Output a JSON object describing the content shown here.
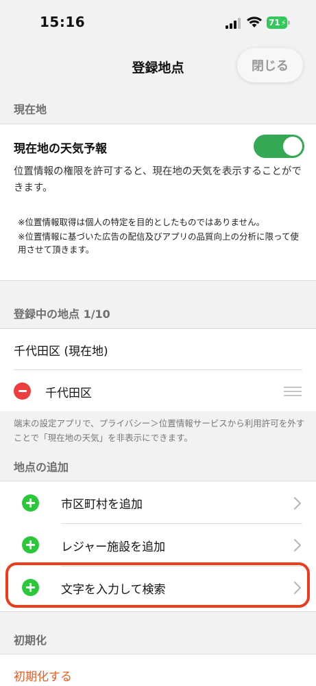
{
  "status": {
    "time": "15:16",
    "battery": "71"
  },
  "nav": {
    "title": "登録地点",
    "close_label": "閉じる"
  },
  "current_location": {
    "header": "現在地",
    "toggle_label": "現在地の天気予報",
    "toggle_on": true,
    "description": "位置情報の権限を許可すると、現在地の天気を表示することができます。",
    "notes": [
      "※位置情報取得は個人の特定を目的としたものではありません。",
      "※位置情報に基づいた広告の配信及びアプリの品質向上の分析に限って使用させて頂きます。"
    ]
  },
  "registered": {
    "header": "登録中の地点 1/10",
    "items": [
      {
        "label": "千代田区 (現在地)"
      },
      {
        "label": "千代田区"
      }
    ],
    "footer": "端末の設定アプリで、プライバシー＞位置情報サービスから利用許可を外すことで「現在地の天気」を非表示にできます。"
  },
  "add": {
    "header": "地点の追加",
    "items": [
      {
        "label": "市区町村を追加"
      },
      {
        "label": "レジャー施設を追加"
      },
      {
        "label": "文字を入力して検索"
      }
    ]
  },
  "reset": {
    "header": "初期化",
    "label": "初期化する"
  },
  "colors": {
    "accent_green": "#34a853",
    "plus_green": "#2bc93a",
    "minus_red": "#ec3e3e",
    "highlight_red": "#f03a1c",
    "reset_orange": "#f05a1c"
  }
}
